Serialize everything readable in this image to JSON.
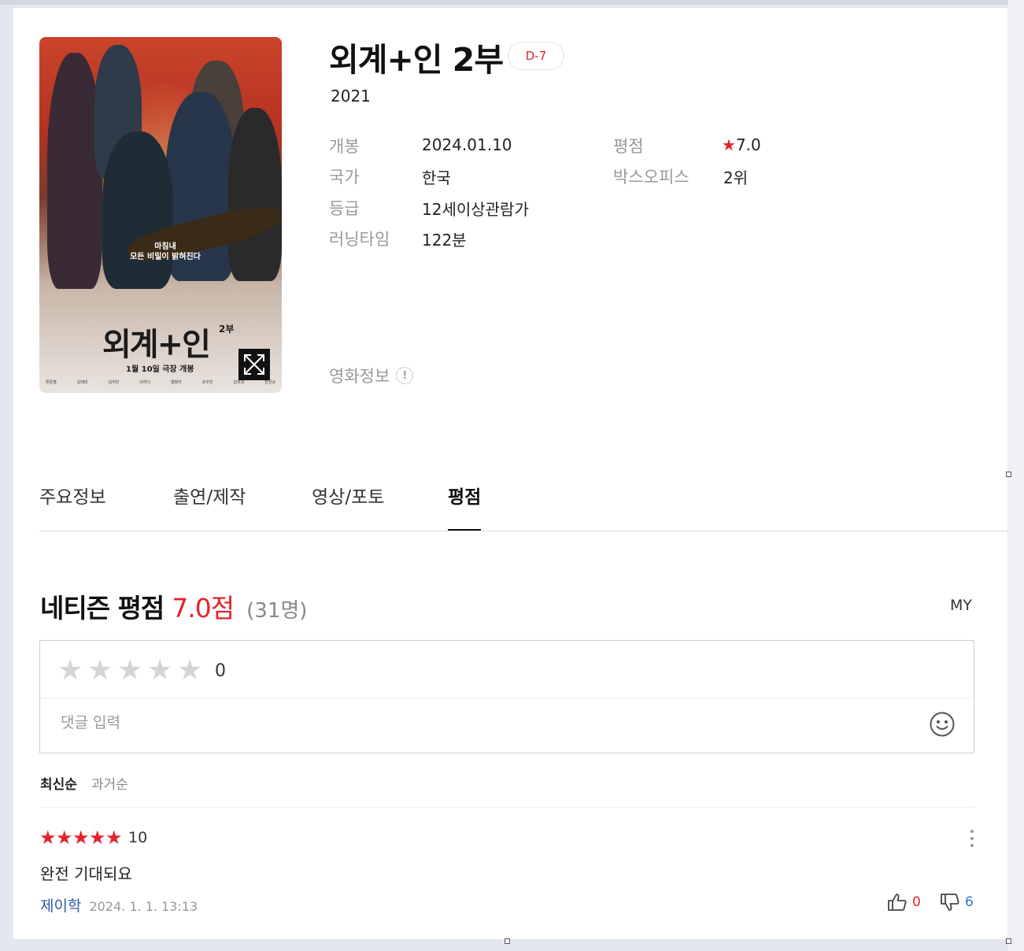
{
  "movie": {
    "title": "외계+인 2부",
    "dday": "D-7",
    "year": "2021",
    "poster": {
      "tagline_1": "마침내",
      "tagline_2": "모든 비밀이 밝혀진다",
      "title": "외계+인",
      "title_sup": "2부",
      "release_text": "1월 10일 극장 개봉",
      "cast": [
        "류준열",
        "김태리",
        "김우빈",
        "이하늬",
        "염정아",
        "조우진",
        "김의성",
        "진선규"
      ]
    },
    "info": {
      "open_label": "개봉",
      "open_value": "2024.01.10",
      "country_label": "국가",
      "country_value": "한국",
      "grade_label": "등급",
      "grade_value": "12세이상관람가",
      "runtime_label": "러닝타임",
      "runtime_value": "122분",
      "rating_label": "평점",
      "rating_star": "★",
      "rating_value": "7.0",
      "boxoffice_label": "박스오피스",
      "boxoffice_value": "2위"
    },
    "movie_info_link": "영화정보",
    "movie_info_icon": "!"
  },
  "tabs": [
    {
      "label": "주요정보",
      "active": false
    },
    {
      "label": "출연/제작",
      "active": false
    },
    {
      "label": "영상/포토",
      "active": false
    },
    {
      "label": "평점",
      "active": true
    }
  ],
  "rating": {
    "title": "네티즌 평점",
    "score": "7.0점",
    "count": "(31명)",
    "my_link": "MY",
    "input": {
      "stars": [
        "★",
        "★",
        "★",
        "★",
        "★"
      ],
      "score": "0",
      "placeholder": "댓글 입력"
    },
    "sort": {
      "latest": "최신순",
      "oldest": "과거순"
    }
  },
  "reviews": [
    {
      "stars": [
        "★",
        "★",
        "★",
        "★",
        "★"
      ],
      "score": "10",
      "text": "완전 기대되요",
      "user": "제이학",
      "date": "2024. 1. 1. 13:13",
      "likes": "0",
      "dislikes": "6"
    }
  ],
  "colors": {
    "accent_red": "#e3232b",
    "user_blue": "#2f5aa8",
    "dislike_blue": "#3b6fd1"
  },
  "icons": {
    "expand": "expand-icon",
    "emoji": "smiley-icon",
    "more": "more-vertical-icon",
    "like": "thumbs-up-icon",
    "dislike": "thumbs-down-icon"
  }
}
